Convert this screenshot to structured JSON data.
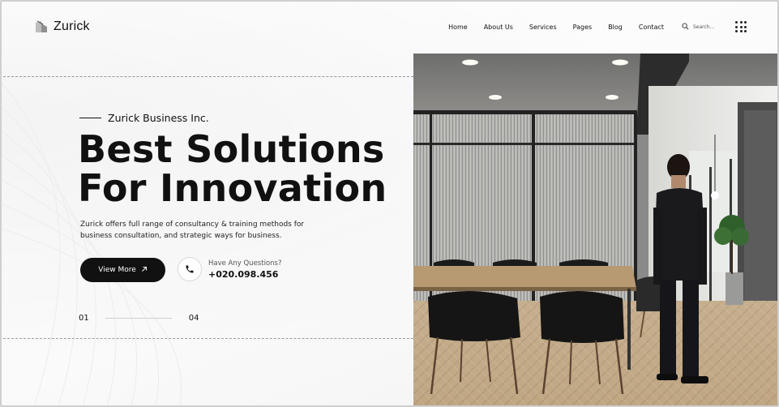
{
  "brand": {
    "name": "Zurick"
  },
  "nav": {
    "items": [
      "Home",
      "About Us",
      "Services",
      "Pages",
      "Blog",
      "Contact"
    ],
    "search_placeholder": "Search..."
  },
  "hero": {
    "eyebrow": "Zurick Business Inc.",
    "headline_line1": "Best Solutions",
    "headline_line2": "For Innovation",
    "description": "Zurick offers full range of consultancy & training methods for business consultation, and strategic ways for business.",
    "cta_label": "View More",
    "phone_label": "Have Any Questions?",
    "phone_number": "+020.098.456"
  },
  "slider": {
    "current": "01",
    "total": "04"
  },
  "colors": {
    "primary": "#111111",
    "accent": "#ffffff"
  },
  "icons": {
    "logo": "logo-mark-icon",
    "search": "search-icon",
    "menu": "grid-menu-icon",
    "cta_arrow": "arrow-up-right-icon",
    "phone": "phone-icon"
  }
}
